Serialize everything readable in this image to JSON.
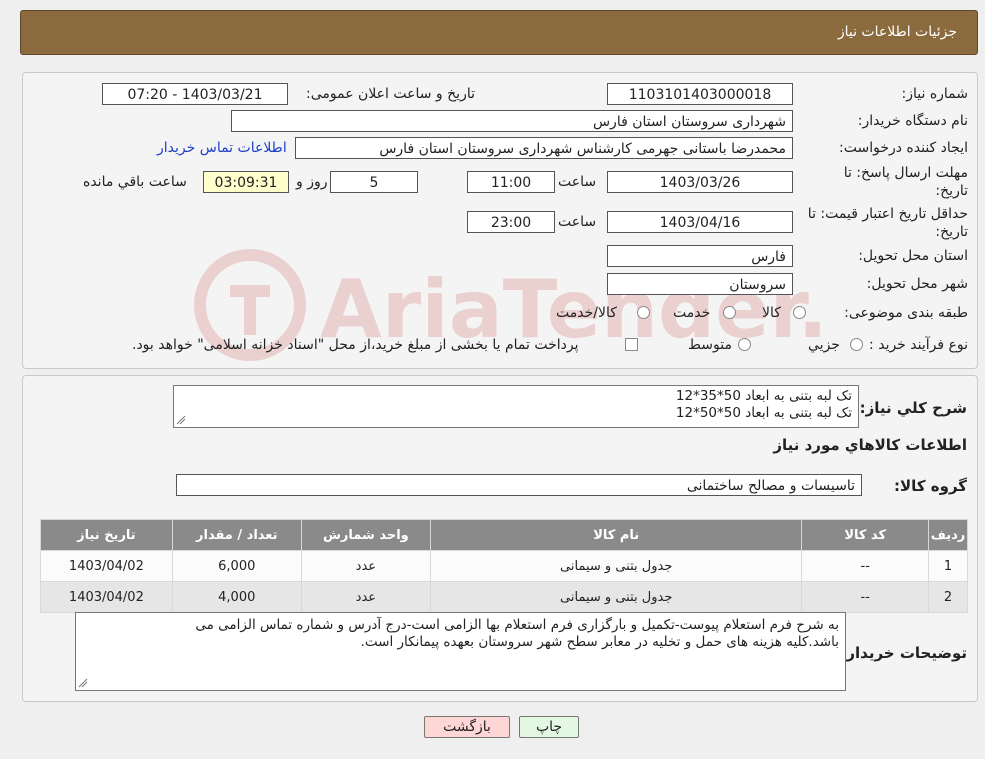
{
  "header": {
    "title": "جزئیات اطلاعات نیاز"
  },
  "form": {
    "need_number_label": "شماره نیاز:",
    "need_number": "1103101403000018",
    "announce_label": "تاریخ و ساعت اعلان عمومی:",
    "announce_value": "1403/03/21 - 07:20",
    "buyer_org_label": "نام دستگاه خریدار:",
    "buyer_org": "شهرداری سروستان استان فارس",
    "creator_label": "ایجاد کننده درخواست:",
    "creator": "محمدرضا باستانی جهرمی کارشناس شهرداری سروستان استان فارس",
    "contact_link": "اطلاعات تماس خریدار",
    "deadline_label_1": "مهلت ارسال پاسخ: تا",
    "deadline_label_2": "تاریخ:",
    "deadline_date": "1403/03/26",
    "time_label": "ساعت",
    "deadline_time": "11:00",
    "days_value": "5",
    "days_label": "روز و",
    "remaining_time": "03:09:31",
    "remaining_label": "ساعت باقي مانده",
    "validity_label_1": "حداقل تاریخ اعتبار قیمت: تا",
    "validity_label_2": "تاریخ:",
    "validity_date": "1403/04/16",
    "validity_time": "23:00",
    "province_label": "استان محل تحویل:",
    "province": "فارس",
    "city_label": "شهر محل تحویل:",
    "city": "سروستان",
    "category_label": "طبقه بندی موضوعی:",
    "category_options": [
      "کالا",
      "خدمت",
      "کالا/خدمت"
    ],
    "process_label": "نوع فرآیند خرید :",
    "process_options": [
      "جزیي",
      "متوسط"
    ],
    "payment_note": "پرداخت تمام یا بخشی از مبلغ خرید،از محل \"اسناد خزانه اسلامی\" خواهد بود."
  },
  "summary": {
    "label": "شرح کلي نياز:",
    "lines": [
      "تک لبه بتنی به ابعاد 50*35*12",
      "تک لبه بتنی به ابعاد 50*50*12"
    ]
  },
  "goods": {
    "section_title": "اطلاعات کالاهاي مورد نياز",
    "group_label": "گروه کالا:",
    "group_value": "تاسیسات و مصالح ساختمانی",
    "columns": [
      "رديف",
      "کد کالا",
      "نام کالا",
      "واحد شمارش",
      "تعداد / مقدار",
      "تاریخ نیاز"
    ],
    "rows": [
      [
        "1",
        "--",
        "جدول بتنی و سیمانی",
        "عدد",
        "6,000",
        "1403/04/02"
      ],
      [
        "2",
        "--",
        "جدول بتنی و سیمانی",
        "عدد",
        "4,000",
        "1403/04/02"
      ]
    ]
  },
  "notes": {
    "label": "توضیحات خریدار:",
    "lines": [
      "به شرح فرم استعلام پیوست-تکمیل و بارگزاری فرم استعلام بها الزامی است-درج آدرس و شماره تماس الزامی می",
      "باشد.کلیه هزینه های حمل و تخلیه در معابر سطح شهر سروستان بعهده پیمانکار است."
    ]
  },
  "buttons": {
    "print": "چاپ",
    "back": "بازگشت"
  },
  "colors": {
    "header_bg": "#8b6a3e",
    "back_bg": "#ffd6d6",
    "print_bg": "#e3f7e3",
    "link": "#1b3fc8"
  }
}
